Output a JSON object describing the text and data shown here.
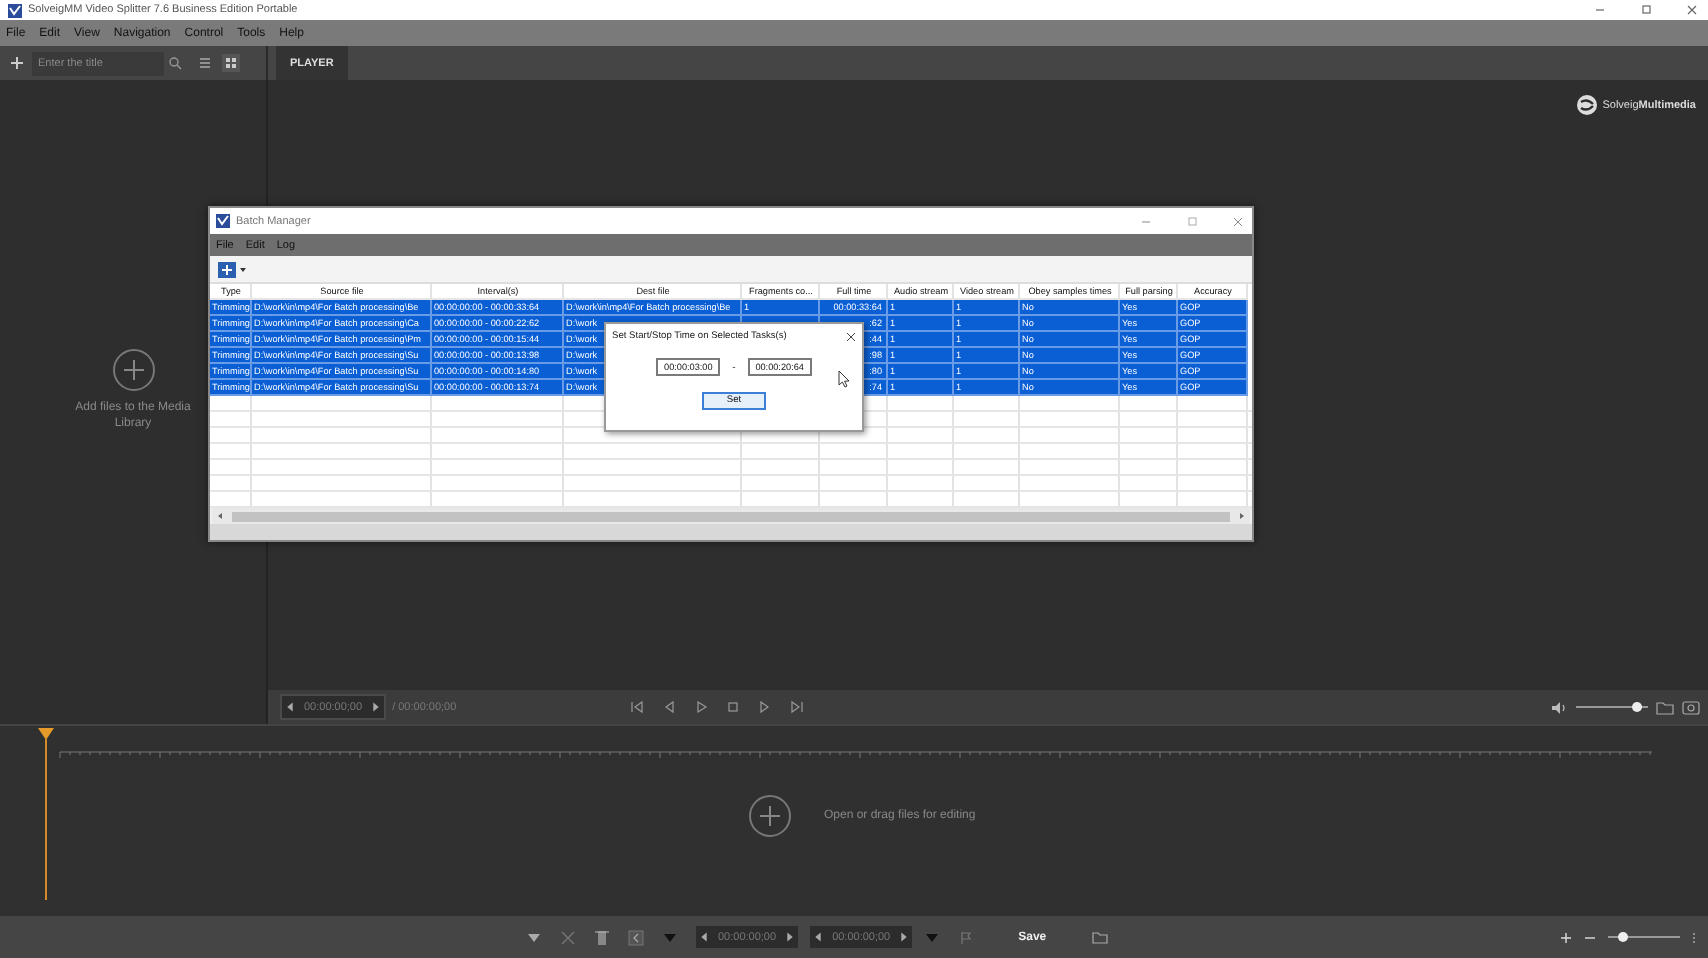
{
  "window": {
    "title": "SolveigMM Video Splitter 7.6 Business Edition Portable"
  },
  "menu": [
    "File",
    "Edit",
    "View",
    "Navigation",
    "Control",
    "Tools",
    "Help"
  ],
  "toolbar": {
    "search": {
      "placeholder": "Enter the title"
    },
    "tabs": [
      {
        "label": "PLAYER",
        "selected": true
      }
    ]
  },
  "media_library": {
    "hint": "Add files to the Media Library"
  },
  "logo": {
    "text": "Solveig**Multimedia**"
  },
  "batch_manager": {
    "title": "Batch Manager",
    "menu": [
      "File",
      "Edit",
      "Log"
    ],
    "columns": [
      "Type",
      "Source file",
      "Interval(s)",
      "Dest file",
      "Fragments co...",
      "Full time",
      "Audio stream",
      "Video stream",
      "Obey samples times",
      "Full parsing",
      "Accuracy"
    ],
    "rows": [
      {
        "selected": true,
        "cells": [
          "Trimming",
          "D:\\work\\in\\mp4\\For Batch processing\\Be",
          "00:00:00:00 - 00:00:33:64",
          "D:\\work\\in\\mp4\\For Batch processing\\Be",
          "1",
          "00:00:33:64",
          "1",
          "1",
          "No",
          "Yes",
          "GOP"
        ]
      },
      {
        "selected": true,
        "cells": [
          "Trimming",
          "D:\\work\\in\\mp4\\For Batch processing\\Ca",
          "00:00:00:00 - 00:00:22:62",
          "D:\\work",
          null,
          ":62",
          "1",
          "1",
          "No",
          "Yes",
          "GOP"
        ]
      },
      {
        "selected": true,
        "cells": [
          "Trimming",
          "D:\\work\\in\\mp4\\For Batch processing\\Pm",
          "00:00:00:00 - 00:00:15:44",
          "D:\\work",
          null,
          ":44",
          "1",
          "1",
          "No",
          "Yes",
          "GOP"
        ]
      },
      {
        "selected": true,
        "cells": [
          "Trimming",
          "D:\\work\\in\\mp4\\For Batch processing\\Su",
          "00:00:00:00 - 00:00:13:98",
          "D:\\work",
          null,
          ":98",
          "1",
          "1",
          "No",
          "Yes",
          "GOP"
        ]
      },
      {
        "selected": true,
        "cells": [
          "Trimming",
          "D:\\work\\in\\mp4\\For Batch processing\\Su",
          "00:00:00:00 - 00:00:14:80",
          "D:\\work",
          null,
          ":80",
          "1",
          "1",
          "No",
          "Yes",
          "GOP"
        ]
      },
      {
        "selected": true,
        "cells": [
          "Trimming",
          "D:\\work\\in\\mp4\\For Batch processing\\Su",
          "00:00:00:00 - 00:00:13:74",
          "D:\\work",
          null,
          ":74",
          "1",
          "1",
          "No",
          "Yes",
          "GOP"
        ]
      }
    ],
    "dialog": {
      "title": "Set Start/Stop Time on Selected Tasks(s)",
      "start": "00:00:03:00",
      "separator": "-",
      "stop": "00:00:20:64",
      "button": "Set"
    }
  },
  "player_bar": {
    "position": "00:00:00;00",
    "duration": "/ 00:00:00;00",
    "volume": {
      "level": 0.85
    }
  },
  "timeline": {
    "hint": "Open or drag files for editing"
  },
  "bottom_bar": {
    "start": "00:00:00;00",
    "end": "00:00:00;00",
    "save": "Save",
    "zoom": {
      "level": 0.2
    }
  }
}
